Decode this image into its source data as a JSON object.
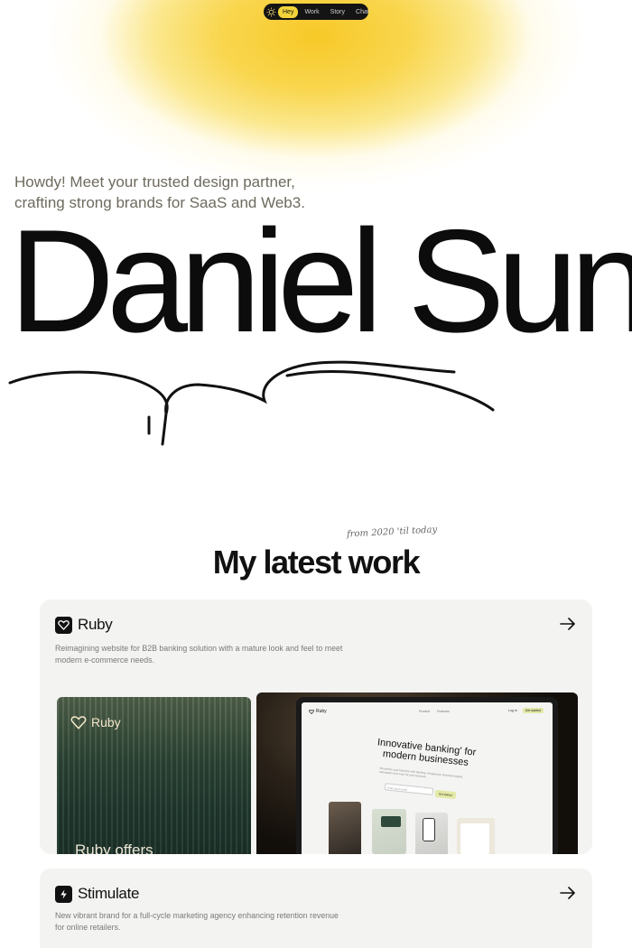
{
  "nav": {
    "items": [
      {
        "label": "Hey",
        "active": true
      },
      {
        "label": "Work",
        "active": false
      },
      {
        "label": "Story",
        "active": false
      },
      {
        "label": "Chat",
        "active": false
      }
    ]
  },
  "hero": {
    "tagline_line1": "Howdy! Meet your trusted design partner,",
    "tagline_line2": "crafting strong brands for SaaS and Web3.",
    "name": "Daniel Sun"
  },
  "work": {
    "since": "from 2020 'til today",
    "title": "My latest work",
    "projects": [
      {
        "name": "Ruby",
        "description": "Reimagining website for B2B banking solution with a mature look and feel to meet modern e-commerce needs.",
        "preview_tag": "Ruby",
        "preview_caption": "Ruby offers",
        "screen": {
          "logo": "Ruby",
          "nav": [
            "Product",
            "Features"
          ],
          "login": "Log in",
          "start": "Get started",
          "headline": "Innovative banking' for modern businesses",
          "sub": "Streamline your business with banking, integrations, financial insights, automation and more for your business.",
          "input_placeholder": "Enter your email",
          "submit": "Get started"
        }
      },
      {
        "name": "Stimulate",
        "description": "New vibrant brand for a full-cycle marketing agency enhancing retention revenue for online retailers."
      }
    ]
  },
  "colors": {
    "accent": "#f2d43a",
    "glow": "#f7c928",
    "text": "#111111",
    "card_bg": "#f3f3f2"
  },
  "icons": [
    "sun-logo-icon",
    "heart-gem-icon",
    "lightning-badge-icon",
    "arrow-right-icon"
  ]
}
